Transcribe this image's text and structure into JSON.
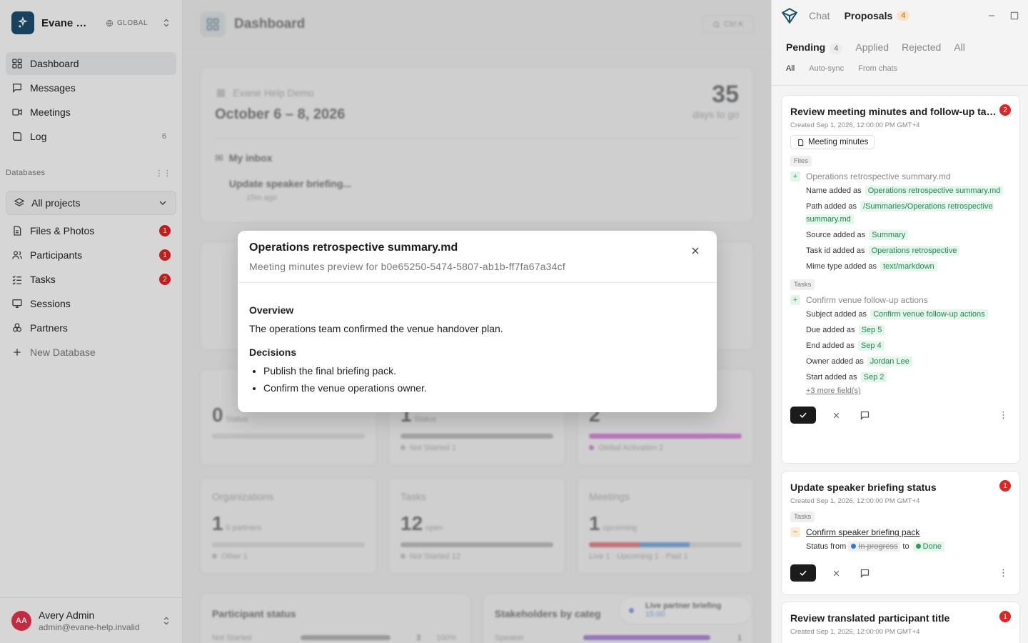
{
  "workspace": {
    "name": "Evane Help Demo",
    "scope": "GLOBAL"
  },
  "nav": [
    {
      "label": "Dashboard",
      "icon": "grid-icon"
    },
    {
      "label": "Messages",
      "icon": "message-icon"
    },
    {
      "label": "Meetings",
      "icon": "video-icon"
    },
    {
      "label": "Log",
      "icon": "book-icon",
      "count": "6"
    }
  ],
  "databases": {
    "label": "Databases",
    "selector": "All projects",
    "items": [
      {
        "label": "Files & Photos",
        "badge": "1"
      },
      {
        "label": "Participants",
        "badge": "1"
      },
      {
        "label": "Tasks",
        "badge": "2"
      },
      {
        "label": "Sessions"
      },
      {
        "label": "Partners"
      }
    ],
    "new_label": "New Database"
  },
  "user": {
    "initials": "AA",
    "name": "Avery Admin",
    "email": "admin@evane-help.invalid"
  },
  "main": {
    "title": "Dashboard",
    "search_hint": "Ctrl K",
    "event": {
      "name": "Evane Help Demo",
      "dates": "October 6 – 8, 2026",
      "countdown": "35",
      "countdown_label": "days to go"
    },
    "inbox": {
      "label": "My inbox",
      "item": "Update speaker briefing...",
      "time": "15m ago"
    },
    "stats": [
      {
        "label": "Organizations",
        "value": "1",
        "sub": "0 partners",
        "legend": "Other",
        "legend_value": "1"
      },
      {
        "label": "Tasks",
        "value": "12",
        "sub": "open",
        "legend": "Not Started",
        "legend_value": "12"
      },
      {
        "label": "Meetings",
        "value": "1",
        "sub": "upcoming",
        "legend": "Live 1 · Upcoming 1 · Past 1"
      }
    ],
    "row1": [
      {
        "value": "0",
        "sub": "Status"
      },
      {
        "value": "1",
        "sub": "Status",
        "legend": "Not Started",
        "legend_value": "1"
      },
      {
        "value": "2",
        "legend": "Global Activation",
        "legend_value": "2"
      }
    ],
    "bottom": [
      {
        "label": "Participant status",
        "row": "Not Started",
        "value": "3",
        "pct": "100%"
      },
      {
        "label": "Stakeholders by categ",
        "row": "Speaker",
        "value": "1"
      }
    ],
    "toast": {
      "title": "Live partner briefing",
      "time": "15:00"
    }
  },
  "modal": {
    "title": "Operations retrospective summary.md",
    "subtitle": "Meeting minutes preview for b0e65250-5474-5807-ab1b-ff7fa67a34cf",
    "h1": "Overview",
    "p1": "The operations team confirmed the venue handover plan.",
    "h2": "Decisions",
    "bullets": [
      "Publish the final briefing pack.",
      "Confirm the venue operations owner."
    ]
  },
  "panel": {
    "tabs": {
      "chat": "Chat",
      "proposals": "Proposals",
      "proposals_count": "4"
    },
    "status_tabs": {
      "pending": "Pending",
      "pending_count": "4",
      "applied": "Applied",
      "rejected": "Rejected",
      "all": "All"
    },
    "filters": {
      "all": "All",
      "auto": "Auto-sync",
      "chats": "From chats"
    },
    "proposals": [
      {
        "title": "Review meeting minutes and follow-up tasks",
        "badge": "2",
        "created": "Created Sep 1, 2026, 12:00:00 PM GMT+4",
        "chip": "Meeting minutes",
        "files_tag": "Files",
        "file_name": "Operations retrospective summary.md",
        "f_name": "Name added as",
        "f_name_val": "Operations retrospective summary.md",
        "f_path": "Path added as",
        "f_path_val": "/Summaries/Operations retrospective summary.md",
        "f_source": "Source added as",
        "f_source_val": "Summary",
        "f_task": "Task id added as",
        "f_task_val": "Operations retrospective",
        "f_mime": "Mime type added as",
        "f_mime_val": "text/markdown",
        "tasks_tag": "Tasks",
        "task_name": "Confirm venue follow-up actions",
        "t_subject": "Subject added as",
        "t_subject_val": "Confirm venue follow-up actions",
        "t_due": "Due added as",
        "t_due_val": "Sep 5",
        "t_end": "End added as",
        "t_end_val": "Sep 4",
        "t_owner": "Owner added as",
        "t_owner_val": "Jordan Lee",
        "t_start": "Start added as",
        "t_start_val": "Sep 2",
        "more": "+3 more field(s)"
      },
      {
        "title": "Update speaker briefing status",
        "badge": "1",
        "created": "Created Sep 1, 2026, 12:00:00 PM GMT+4",
        "tasks_tag": "Tasks",
        "task_name": "Confirm speaker briefing pack",
        "status_label": "Status from",
        "status_old": "In progress",
        "status_to": "to",
        "status_new": "Done"
      },
      {
        "title": "Review translated participant title",
        "badge": "1",
        "created": "Created Sep 1, 2026, 12:00:00 PM GMT+4"
      }
    ]
  }
}
